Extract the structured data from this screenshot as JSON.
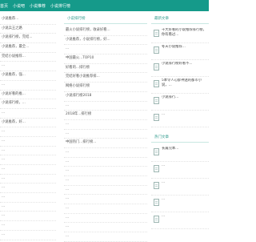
{
  "nav": {
    "items": [
      "首页",
      "小说吧",
      "小说推荐",
      "小说排行榜"
    ]
  },
  "left": {
    "items": [
      "小说推荐...",
      "小说兵王之路",
      "小说排行榜，完结...",
      "小说推荐，最全...",
      "完结小说推荐...",
      "...",
      "小说推荐，强...",
      "...",
      "小说好看的推...",
      "小说排行榜，...",
      "...",
      "小说推荐，好...",
      "...",
      "...",
      "...",
      "...",
      "...",
      "...",
      "...",
      "...",
      "...",
      "...",
      "...",
      "..."
    ]
  },
  "mid": {
    "title": "小说排行榜",
    "items": [
      "最火小说排行榜，收录好看...",
      "小说推荐，小说排行榜，好...",
      "...",
      "中国最火...TOP10",
      "好看的...排行榜",
      "完结好看小说推荐排...",
      "网络小说排行榜",
      "小说排行榜2018",
      "...",
      "2018年...排行榜",
      "...",
      "...",
      "中国热门...排行榜...",
      "...",
      "...",
      "...",
      "...",
      "...",
      "...",
      "...",
      "...",
      "...",
      "...",
      "..."
    ]
  },
  "right": {
    "section1_title": "最新文章",
    "section1_items": [
      "十大好看的小说推荐排行榜，你有看过...",
      "冬天小说推荐...",
      "小说排行榜好看不...",
      "5本令人心醉神迷的都市小说，...",
      "小说排行...",
      "..."
    ],
    "section2_title": "热门文章",
    "section2_items": [
      "长篇完本...",
      "...",
      "...",
      "...",
      "..."
    ]
  }
}
